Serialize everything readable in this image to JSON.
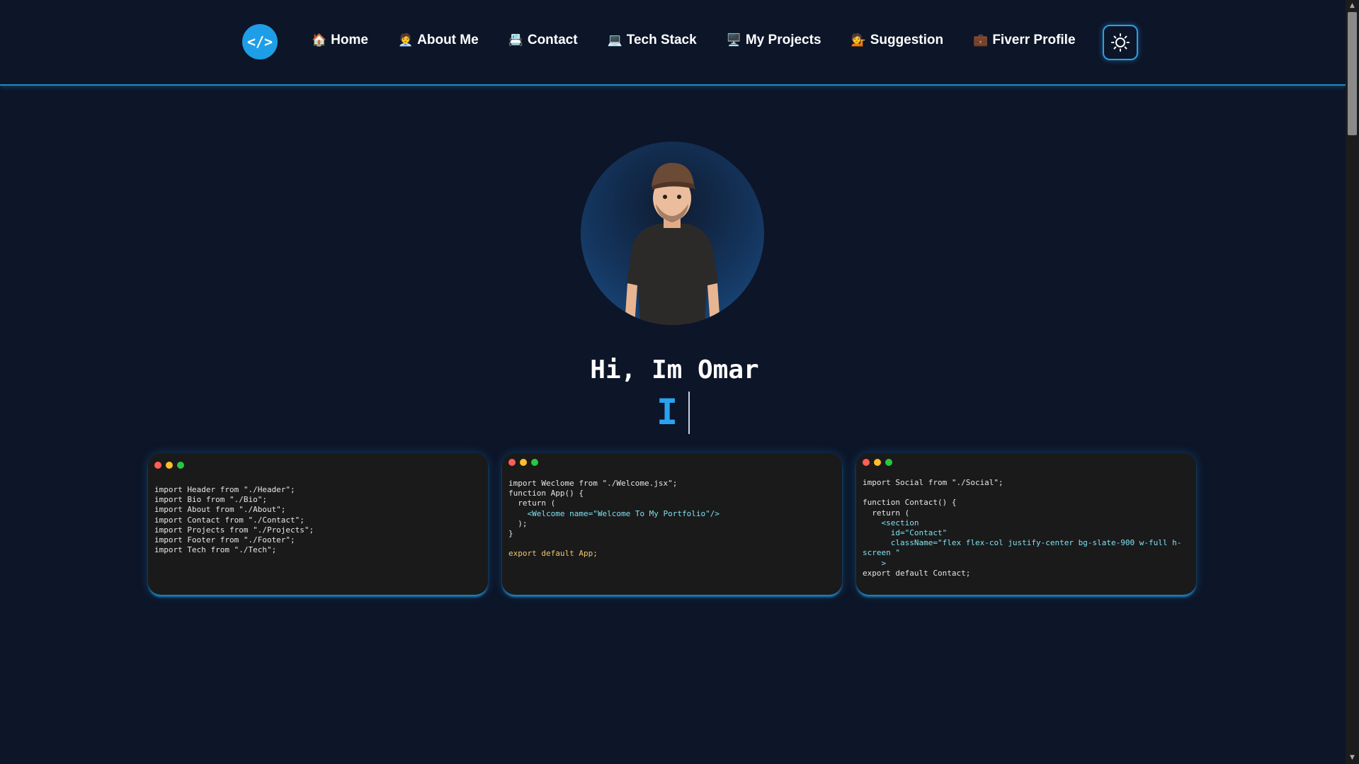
{
  "logo": {
    "glyph": "</>"
  },
  "nav": {
    "items": [
      {
        "icon": "🏠",
        "label": "Home"
      },
      {
        "icon": "🧑‍💼",
        "label": "About Me"
      },
      {
        "icon": "📇",
        "label": "Contact"
      },
      {
        "icon": "💻",
        "label": "Tech Stack"
      },
      {
        "icon": "🖥️",
        "label": "My Projects"
      },
      {
        "icon": "💁",
        "label": "Suggestion"
      },
      {
        "icon": "💼",
        "label": "Fiverr Profile"
      }
    ],
    "theme_toggle_icon": "sun-icon"
  },
  "hero": {
    "greeting": "Hi, Im Omar",
    "typed_text": "I"
  },
  "code_cards": [
    {
      "lines": [
        "import Header from \"./Header\";",
        "import Bio from \"./Bio\";",
        "import About from \"./About\";",
        "import Contact from \"./Contact\";",
        "import Projects from \"./Projects\";",
        "import Footer from \"./Footer\";",
        "import Tech from \"./Tech\";"
      ]
    },
    {
      "lines": [
        "import Weclome from \"./Welcome.jsx\";",
        "function App() {",
        "  return (",
        "    <Welcome name=\"Welcome To My Portfolio\"/>",
        "  );",
        "}",
        "",
        "export default App;"
      ]
    },
    {
      "lines": [
        "import Social from \"./Social\";",
        "",
        "function Contact() {",
        "  return (",
        "    <section",
        "      id=\"Contact\"",
        "      className=\"flex flex-col justify-center bg-slate-900 w-full h-screen \"",
        "    >",
        "export default Contact;"
      ]
    }
  ],
  "colors": {
    "background": "#0d1528",
    "accent": "#1e9ee6",
    "card": "#1a1a1a",
    "dot_red": "#ff5f57",
    "dot_yellow": "#febc2e",
    "dot_green": "#28c840"
  }
}
